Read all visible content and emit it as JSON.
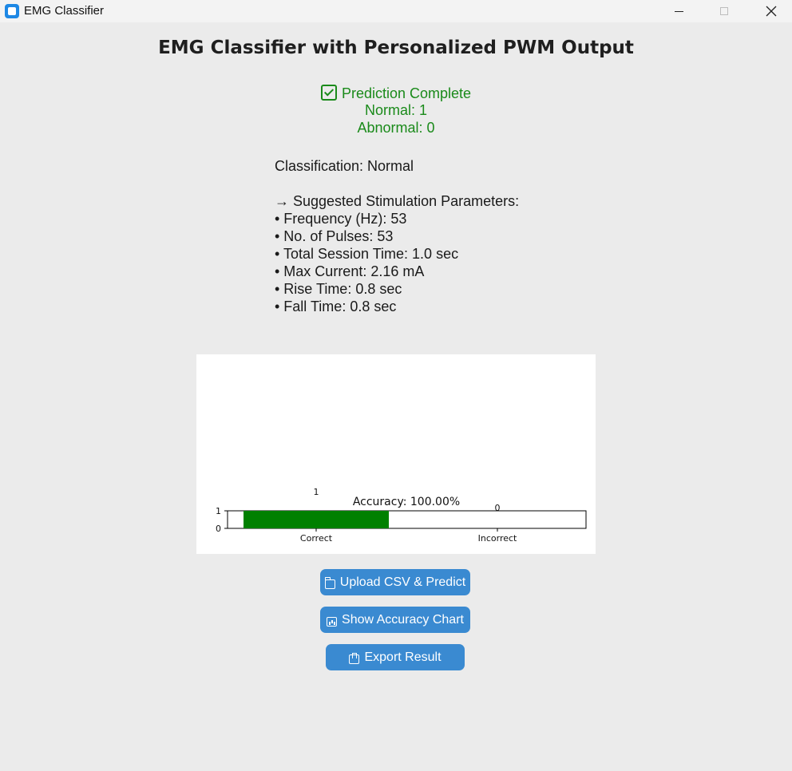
{
  "window": {
    "title": "EMG Classifier"
  },
  "heading": "EMG Classifier with Personalized PWM Output",
  "status": {
    "complete": "Prediction Complete",
    "normal": "Normal: 1",
    "abnormal": "Abnormal: 0",
    "color": "#1a8a1a"
  },
  "result": {
    "classification": "Classification: Normal",
    "params_header": "→ Suggested Stimulation Parameters:",
    "params": [
      "• Frequency (Hz): 53",
      "• No. of Pulses: 53",
      "• Total Session Time: 1.0 sec",
      "• Max Current: 2.16 mA",
      "• Rise Time: 0.8 sec",
      "• Fall Time: 0.8 sec"
    ]
  },
  "chart_data": {
    "type": "bar",
    "title": "Accuracy: 100.00%",
    "categories": [
      "Correct",
      "Incorrect"
    ],
    "values": [
      1,
      0
    ],
    "data_labels": [
      "1",
      "0"
    ],
    "yticks": [
      "0",
      "1"
    ],
    "ylim": [
      0,
      1
    ],
    "bar_color": "#008000",
    "grid": false
  },
  "buttons": {
    "upload": "Upload CSV & Predict",
    "chart": "Show Accuracy Chart",
    "export": "Export Result",
    "color": "#3a8ad1"
  }
}
